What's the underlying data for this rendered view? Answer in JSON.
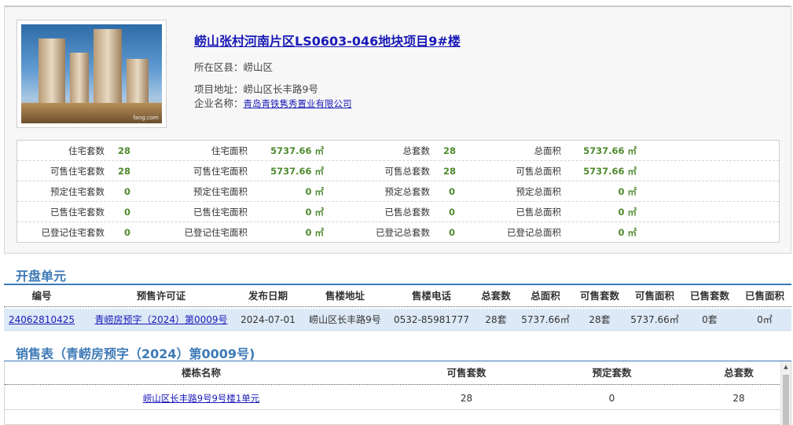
{
  "project": {
    "title": "崂山张村河南片区LS0603-046地块项目9#楼",
    "district_label": "所在区县：",
    "district": "崂山区",
    "address_label": "项目地址：",
    "address": "崂山区长丰路9号",
    "company_label": "企业名称：",
    "company": "青岛青铁隽秀置业有限公司",
    "photo_watermark": "fang.com"
  },
  "stats": [
    [
      {
        "label": "住宅套数",
        "value": "28"
      },
      {
        "label": "住宅面积",
        "value": "5737.66 ㎡"
      },
      {
        "label": "总套数",
        "value": "28"
      },
      {
        "label": "总面积",
        "value": "5737.66 ㎡"
      }
    ],
    [
      {
        "label": "可售住宅套数",
        "value": "28"
      },
      {
        "label": "可售住宅面积",
        "value": "5737.66 ㎡"
      },
      {
        "label": "可售总套数",
        "value": "28"
      },
      {
        "label": "可售总面积",
        "value": "5737.66 ㎡"
      }
    ],
    [
      {
        "label": "预定住宅套数",
        "value": "0"
      },
      {
        "label": "预定住宅面积",
        "value": "0 ㎡"
      },
      {
        "label": "预定总套数",
        "value": "0"
      },
      {
        "label": "预定总面积",
        "value": "0 ㎡"
      }
    ],
    [
      {
        "label": "已售住宅套数",
        "value": "0"
      },
      {
        "label": "已售住宅面积",
        "value": "0 ㎡"
      },
      {
        "label": "已售总套数",
        "value": "0"
      },
      {
        "label": "已售总面积",
        "value": "0 ㎡"
      }
    ],
    [
      {
        "label": "已登记住宅套数",
        "value": "0"
      },
      {
        "label": "已登记住宅面积",
        "value": "0 ㎡"
      },
      {
        "label": "已登记总套数",
        "value": "0"
      },
      {
        "label": "已登记总面积",
        "value": "0 ㎡"
      }
    ]
  ],
  "units_section": {
    "title": "开盘单元",
    "headers": [
      "编号",
      "预售许可证",
      "发布日期",
      "售楼地址",
      "售楼电话",
      "总套数",
      "总面积",
      "可售套数",
      "可售面积",
      "已售套数",
      "已售面积"
    ],
    "rows": [
      [
        "24062810425",
        "青崂房预字（2024）第0009号",
        "2024-07-01",
        "崂山区长丰路9号",
        "0532-85981777",
        "28套",
        "5737.66㎡",
        "28套",
        "5737.66㎡",
        "0套",
        "0㎡"
      ]
    ]
  },
  "sales_section": {
    "title": "销售表（青崂房预字（2024）第0009号)",
    "headers": [
      "楼栋名称",
      "可售套数",
      "预定套数",
      "总套数"
    ],
    "rows": [
      [
        "崂山区长丰路9号9号楼1单元",
        "28",
        "0",
        "28"
      ]
    ]
  },
  "colors": {
    "accent": "#3e7ab7",
    "link": "#1a1ab8",
    "stat_value": "#4f8a2f",
    "row_highlight": "#dde9f6"
  }
}
